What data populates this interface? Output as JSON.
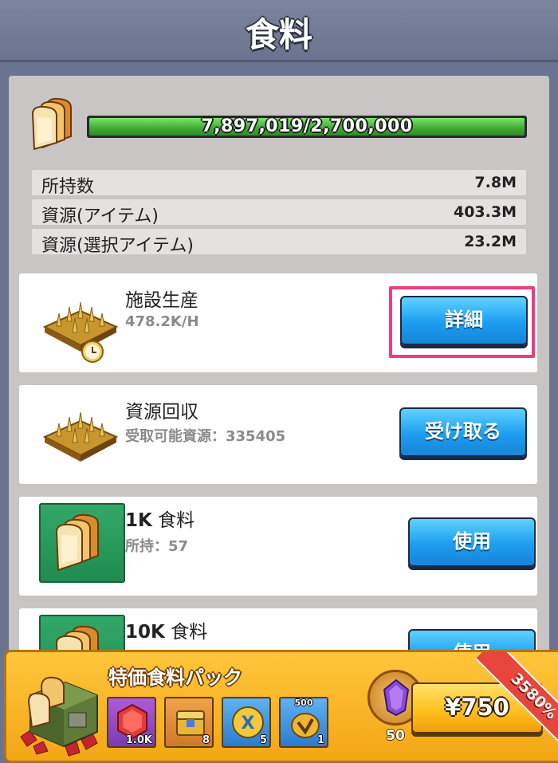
{
  "header": {
    "title": "食料"
  },
  "resource": {
    "progress_text": "7,897,019/2,700,000",
    "progress_fraction": 1.0,
    "stats": [
      {
        "label": "所持数",
        "value": "7.8M"
      },
      {
        "label": "資源(アイテム)",
        "value": "403.3M"
      },
      {
        "label": "資源(選択アイテム)",
        "value": "23.2M"
      }
    ]
  },
  "cards": [
    {
      "title": "施設生産",
      "subtitle": "478.2K/H",
      "button": "詳細",
      "icon": "farm-clock-icon"
    },
    {
      "title": "資源回収",
      "subtitle": "受取可能資源：335405",
      "button": "受け取る",
      "icon": "farm-icon"
    },
    {
      "title_amount": "1K",
      "title_name": "食料",
      "subtitle": "所持：57",
      "button": "使用",
      "icon": "bread-icon"
    },
    {
      "title_amount": "10K",
      "title_name": "食料",
      "subtitle": "",
      "button": "使用",
      "icon": "bread-icon"
    }
  ],
  "pack": {
    "title": "特価食料パック",
    "ribbon": "3580%",
    "rewards": [
      {
        "icon": "red-gem-icon",
        "count": "1.0K",
        "top": ""
      },
      {
        "icon": "gold-chest-icon",
        "count": "8",
        "top": ""
      },
      {
        "icon": "speed-up-icon",
        "count": "5",
        "top": ""
      },
      {
        "icon": "gold-token-icon",
        "count": "1",
        "top": "500"
      }
    ],
    "gem_count": "50",
    "price": "¥750"
  },
  "colors": {
    "accent_highlight": "#ec3d82",
    "button_blue": "#1d9df0",
    "progress_green": "#3eaa32"
  }
}
